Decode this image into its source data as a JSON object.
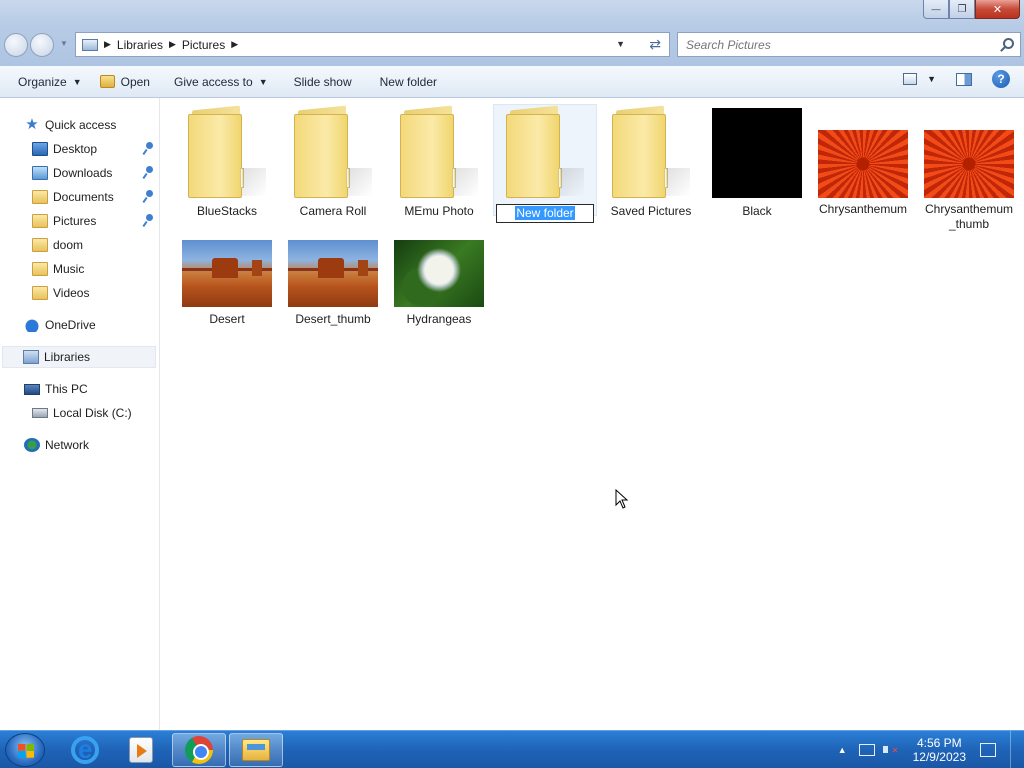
{
  "window": {
    "minimize_glyph": "—",
    "restore_glyph": "❐",
    "close_glyph": "✕"
  },
  "address": {
    "breadcrumbs": [
      "Libraries",
      "Pictures"
    ]
  },
  "search": {
    "placeholder": "Search Pictures"
  },
  "toolbar": {
    "organize": "Organize",
    "open": "Open",
    "give_access": "Give access to",
    "slide_show": "Slide show",
    "new_folder": "New folder",
    "help": "?"
  },
  "sidebar": {
    "quick_access": "Quick access",
    "items": [
      {
        "label": "Desktop",
        "pinned": true
      },
      {
        "label": "Downloads",
        "pinned": true
      },
      {
        "label": "Documents",
        "pinned": true
      },
      {
        "label": "Pictures",
        "pinned": true
      },
      {
        "label": "doom",
        "pinned": false
      },
      {
        "label": "Music",
        "pinned": false
      },
      {
        "label": "Videos",
        "pinned": false
      }
    ],
    "onedrive": "OneDrive",
    "libraries": "Libraries",
    "this_pc": "This PC",
    "local_disk": "Local Disk (C:)",
    "network": "Network"
  },
  "files": [
    {
      "name": "BlueStacks",
      "type": "folder"
    },
    {
      "name": "Camera Roll",
      "type": "folder"
    },
    {
      "name": "MEmu Photo",
      "type": "folder"
    },
    {
      "name": "New folder",
      "type": "folder",
      "renaming": true
    },
    {
      "name": "Saved Pictures",
      "type": "folder"
    },
    {
      "name": "Black",
      "type": "image"
    },
    {
      "name": "Chrysanthemum",
      "type": "image"
    },
    {
      "name": "Chrysanthemum_thumb",
      "type": "image"
    },
    {
      "name": "Desert",
      "type": "image"
    },
    {
      "name": "Desert_thumb",
      "type": "image"
    },
    {
      "name": "Hydrangeas",
      "type": "image"
    }
  ],
  "labels": {
    "chrys_thumb_line1": "Chrysanthemum",
    "chrys_thumb_line2": "_thumb"
  },
  "taskbar": {
    "time": "4:56 PM",
    "date": "12/9/2023"
  }
}
